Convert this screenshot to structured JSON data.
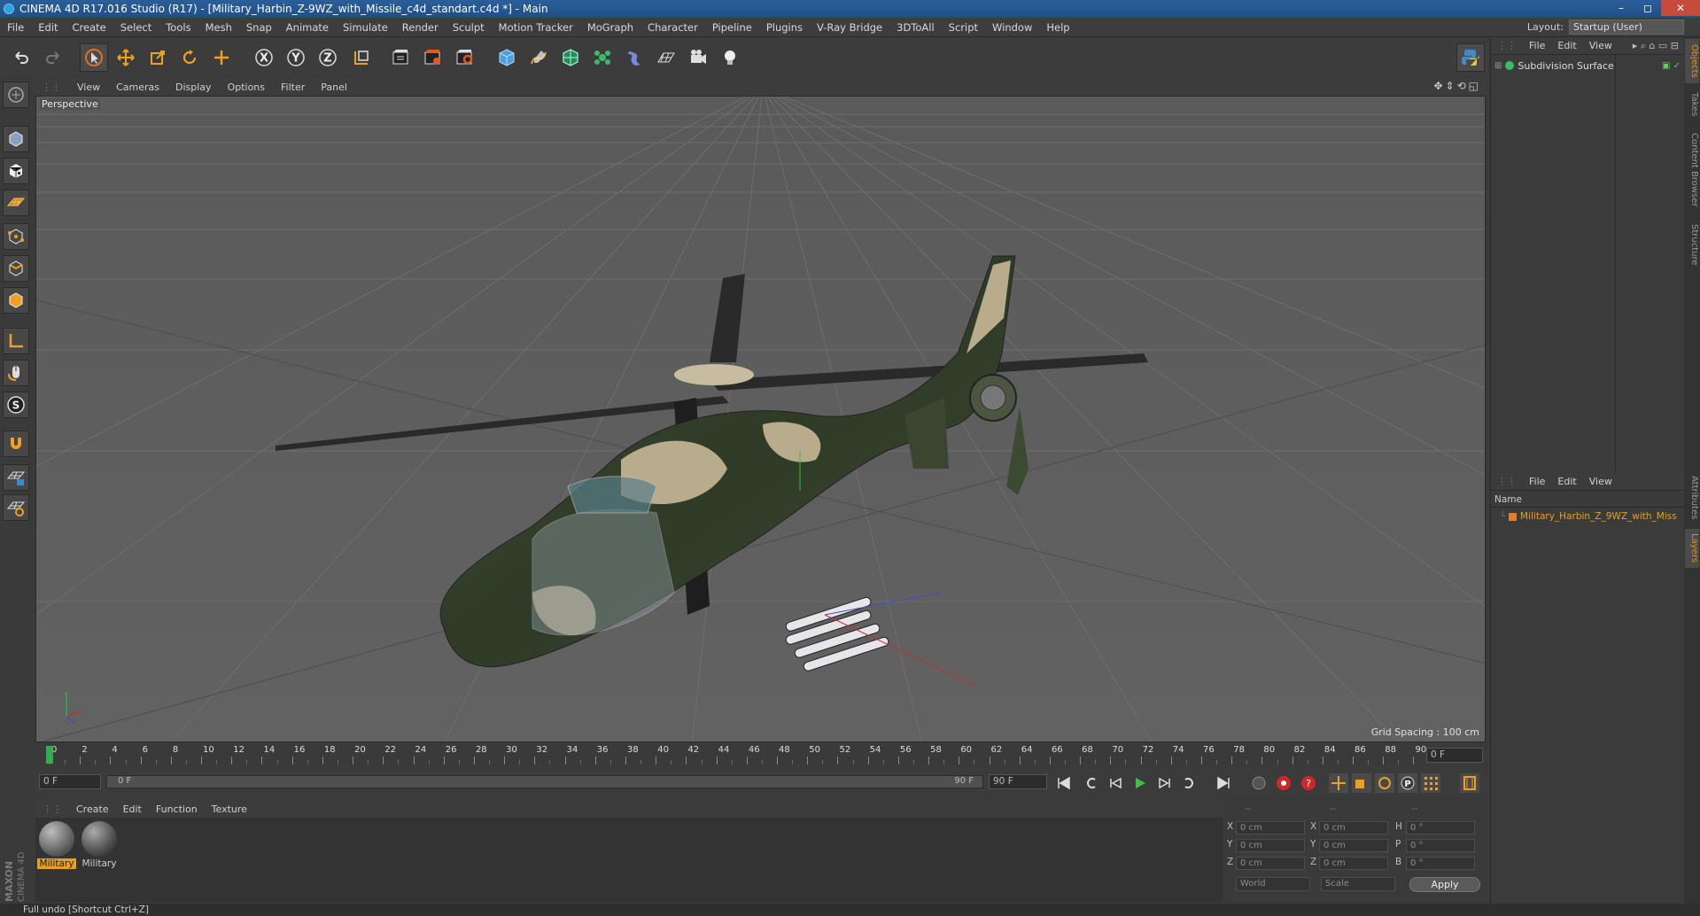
{
  "window": {
    "title": "CINEMA 4D R17.016 Studio (R17) - [Military_Harbin_Z-9WZ_with_Missile_c4d_standart.c4d *] - Main",
    "controls": [
      "–",
      "◻",
      "✕"
    ]
  },
  "menubar": {
    "items": [
      "File",
      "Edit",
      "Create",
      "Select",
      "Tools",
      "Mesh",
      "Snap",
      "Animate",
      "Simulate",
      "Render",
      "Sculpt",
      "Motion Tracker",
      "MoGraph",
      "Character",
      "Pipeline",
      "Plugins",
      "V-Ray Bridge",
      "3DToAll",
      "Script",
      "Window",
      "Help"
    ],
    "layout_label": "Layout:",
    "layout_value": "Startup (User)"
  },
  "toolbar": {
    "icons": [
      "undo-icon",
      "redo-icon",
      "select-arrow-icon",
      "move-icon",
      "scale-icon",
      "rotate-icon",
      "transform-icon",
      "x-axis-icon",
      "y-axis-icon",
      "z-axis-icon",
      "coordinate-system-icon",
      "render-view-icon",
      "render-picture-viewer-icon",
      "render-settings-icon",
      "cube-icon",
      "pen-spline-icon",
      "subdivision-icon",
      "cloner-icon",
      "deformer-icon",
      "floor-icon",
      "camera-icon",
      "light-icon",
      "python-icon"
    ],
    "axis_labels": [
      "X",
      "Y",
      "Z"
    ]
  },
  "viewport": {
    "menu": [
      "View",
      "Cameras",
      "Display",
      "Options",
      "Filter",
      "Panel"
    ],
    "label": "Perspective",
    "grid_spacing": "Grid Spacing : 100 cm"
  },
  "timeline": {
    "ticks": [
      "0",
      "2",
      "4",
      "6",
      "8",
      "10",
      "12",
      "14",
      "16",
      "18",
      "20",
      "22",
      "24",
      "26",
      "28",
      "30",
      "32",
      "34",
      "36",
      "38",
      "40",
      "42",
      "44",
      "46",
      "48",
      "50",
      "52",
      "54",
      "56",
      "58",
      "60",
      "62",
      "64",
      "66",
      "68",
      "70",
      "72",
      "74",
      "76",
      "78",
      "80",
      "82",
      "84",
      "86",
      "88",
      "90"
    ],
    "current_frame": "0 F",
    "start_field": "0 F",
    "range_start": "0 F",
    "range_end": "90 F",
    "end_field": "90 F"
  },
  "material_manager": {
    "menu": [
      "Create",
      "Edit",
      "Function",
      "Texture"
    ],
    "materials": [
      {
        "label": "Military",
        "selected": true
      },
      {
        "label": "Military",
        "selected": false
      }
    ]
  },
  "coordinates": {
    "headers": [
      "--",
      "--",
      "--"
    ],
    "rows": [
      {
        "a": "X",
        "av": "0 cm",
        "b": "X",
        "bv": "0 cm",
        "c": "H",
        "cv": "0 °"
      },
      {
        "a": "Y",
        "av": "0 cm",
        "b": "Y",
        "bv": "0 cm",
        "c": "P",
        "cv": "0 °"
      },
      {
        "a": "Z",
        "av": "0 cm",
        "b": "Z",
        "bv": "0 cm",
        "c": "B",
        "cv": "0 °"
      }
    ],
    "world": "World",
    "scale": "Scale",
    "apply": "Apply"
  },
  "object_manager": {
    "menu": [
      "File",
      "Edit",
      "View"
    ],
    "objects": [
      {
        "name": "Subdivision Surface"
      }
    ]
  },
  "layer_manager": {
    "menu": [
      "File",
      "Edit",
      "View"
    ],
    "name_header": "Name",
    "items": [
      {
        "name": "Military_Harbin_Z_9WZ_with_Miss"
      }
    ]
  },
  "side_tabs": [
    "Objects",
    "Takes",
    "Content Browser",
    "Structure",
    "Attributes",
    "Layers"
  ],
  "status": {
    "text": "Full undo [Shortcut Ctrl+Z]"
  },
  "branding": {
    "logo_text": "MAXON CINEMA 4D"
  },
  "colors": {
    "accent_orange": "#e7a020",
    "title_blue": "#1f4e86"
  }
}
